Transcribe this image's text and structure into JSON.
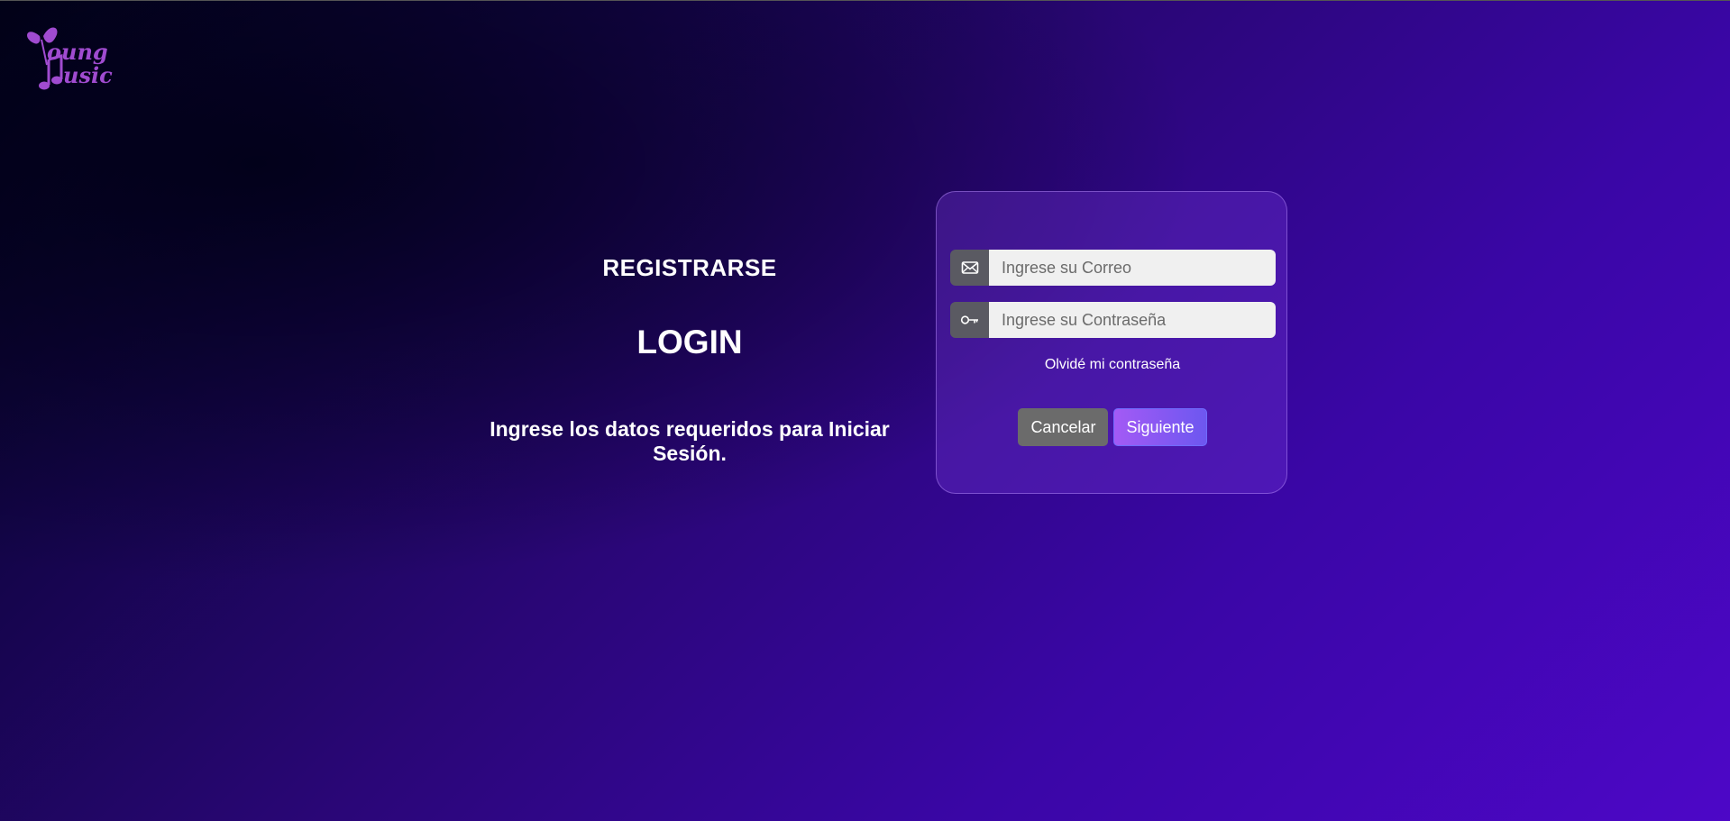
{
  "brand": {
    "logo_line1": "oung",
    "logo_line2": "usic",
    "logo_color": "#a04bd0"
  },
  "left": {
    "register_label": "REGISTRARSE",
    "login_title": "LOGIN",
    "instructions": "Ingrese los datos requeridos para Iniciar Sesión."
  },
  "form": {
    "email_placeholder": "Ingrese su Correo",
    "email_value": "",
    "email_icon": "envelope-icon",
    "password_placeholder": "Ingrese su Contraseña",
    "password_value": "",
    "password_icon": "key-icon",
    "forgot_label": "Olvidé mi contraseña",
    "cancel_label": "Cancelar",
    "next_label": "Siguiente"
  },
  "colors": {
    "accent_gradient_start": "#a35af5",
    "accent_gradient_end": "#6d57f0",
    "cancel_bg": "#6b6b6b",
    "background_dark": "#02021a",
    "background_light": "#4d07c7"
  }
}
